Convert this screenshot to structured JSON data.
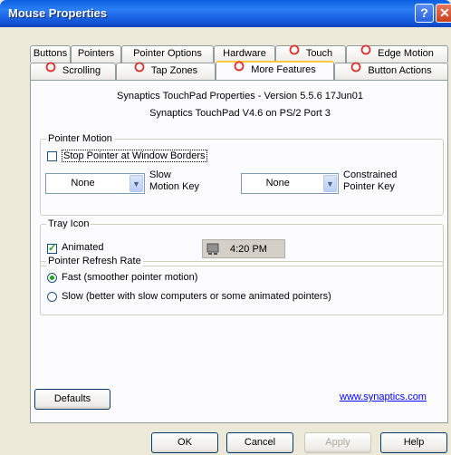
{
  "window": {
    "title": "Mouse Properties",
    "help_glyph": "?",
    "close_glyph": "✕"
  },
  "tabs_row1": [
    "Buttons",
    "Pointers",
    "Pointer Options",
    "Hardware",
    "Touch",
    "Edge Motion"
  ],
  "tabs_row2": [
    "Scrolling",
    "Tap Zones",
    "More Features",
    "Button Actions"
  ],
  "active_tab": "More Features",
  "header": {
    "line1": "Synaptics TouchPad Properties - Version 5.5.6 17Jun01",
    "line2": "Synaptics TouchPad V4.6 on PS/2 Port 3"
  },
  "pointer_motion": {
    "title": "Pointer Motion",
    "stop_label": "Stop Pointer at Window Borders",
    "stop_checked": false,
    "slow_value": "None",
    "slow_label": "Slow\nMotion Key",
    "constrained_value": "None",
    "constrained_label": "Constrained\nPointer Key"
  },
  "tray_icon": {
    "title": "Tray Icon",
    "animated_label": "Animated",
    "animated_checked": true,
    "time": "4:20 PM"
  },
  "refresh": {
    "title": "Pointer Refresh Rate",
    "fast_label": "Fast (smoother pointer motion)",
    "slow_label": "Slow (better with slow computers or some animated pointers)",
    "selected": "fast"
  },
  "defaults_label": "Defaults",
  "link_text": "www.synaptics.com",
  "footer": {
    "ok": "OK",
    "cancel": "Cancel",
    "apply": "Apply",
    "help": "Help"
  },
  "colors": {
    "titlebar": "#0a5fe0",
    "tab_highlight": "#ffc83c",
    "ring": "#d9332b",
    "link": "#0000ff"
  }
}
